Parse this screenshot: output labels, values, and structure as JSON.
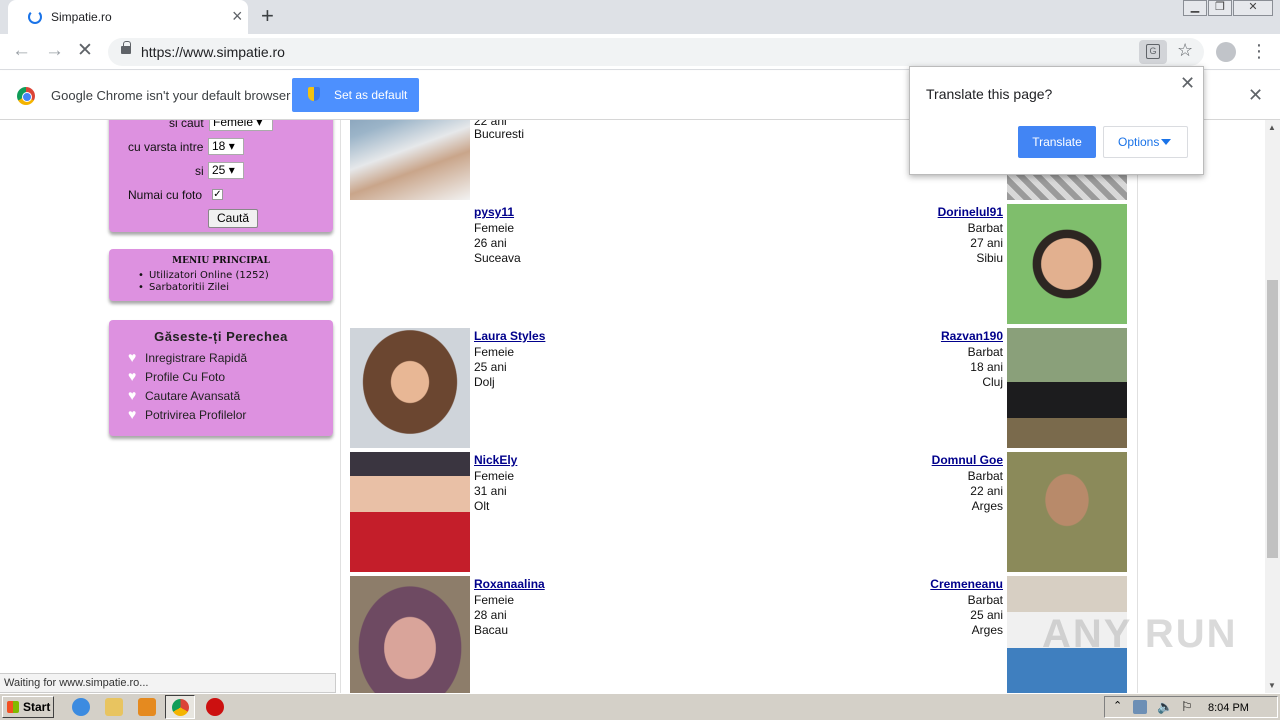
{
  "browser": {
    "tab_title": "Simpatie.ro",
    "url": "https://www.simpatie.ro",
    "infobar_text": "Google Chrome isn't your default browser",
    "set_default_label": "Set as default",
    "status_text": "Waiting for www.simpatie.ro..."
  },
  "translate": {
    "title": "Translate this page?",
    "translate_label": "Translate",
    "options_label": "Options"
  },
  "search_form": {
    "seeking_label": "si caut",
    "seeking_value": "Femeie",
    "age_label": "cu varsta intre",
    "age_min": "18",
    "and_label": "si",
    "age_max": "25",
    "photo_only_label": "Numai cu foto",
    "photo_only_checked": true,
    "search_button": "Caută"
  },
  "main_menu": {
    "title": "MENIU PRINCIPAL",
    "items": [
      "Utilizatori Online (1252)",
      "Sarbatoritii Zilei"
    ]
  },
  "find_partner": {
    "title": "Găseste-ți Perechea",
    "items": [
      "Inregistrare Rapidă",
      "Profile Cu Foto",
      "Cautare Avansată",
      "Potrivirea Profilelor"
    ]
  },
  "profiles_left": [
    {
      "name": "",
      "gender": "",
      "age": "22 ani",
      "city": "Bucuresti"
    },
    {
      "name": "pysy11",
      "gender": "Femeie",
      "age": "26 ani",
      "city": "Suceava"
    },
    {
      "name": "Laura Styles",
      "gender": "Femeie",
      "age": "25 ani",
      "city": "Dolj"
    },
    {
      "name": "NickEly",
      "gender": "Femeie",
      "age": "31 ani",
      "city": "Olt"
    },
    {
      "name": "Roxanaalina",
      "gender": "Femeie",
      "age": "28 ani",
      "city": "Bacau"
    }
  ],
  "profiles_right": [
    {
      "name": "Dorinelul91",
      "gender": "Barbat",
      "age": "27 ani",
      "city": "Sibiu"
    },
    {
      "name": "Razvan190",
      "gender": "Barbat",
      "age": "18 ani",
      "city": "Cluj"
    },
    {
      "name": "Domnul Goe",
      "gender": "Barbat",
      "age": "22 ani",
      "city": "Arges"
    },
    {
      "name": "Cremeneanu",
      "gender": "Barbat",
      "age": "25 ani",
      "city": "Arges"
    }
  ],
  "taskbar": {
    "start_label": "Start",
    "clock": "8:04 PM"
  },
  "watermark": "ANY RUN",
  "colors": {
    "sidebar_box": "#dd91e0",
    "link": "#00008b",
    "chrome_blue": "#4285f4"
  }
}
